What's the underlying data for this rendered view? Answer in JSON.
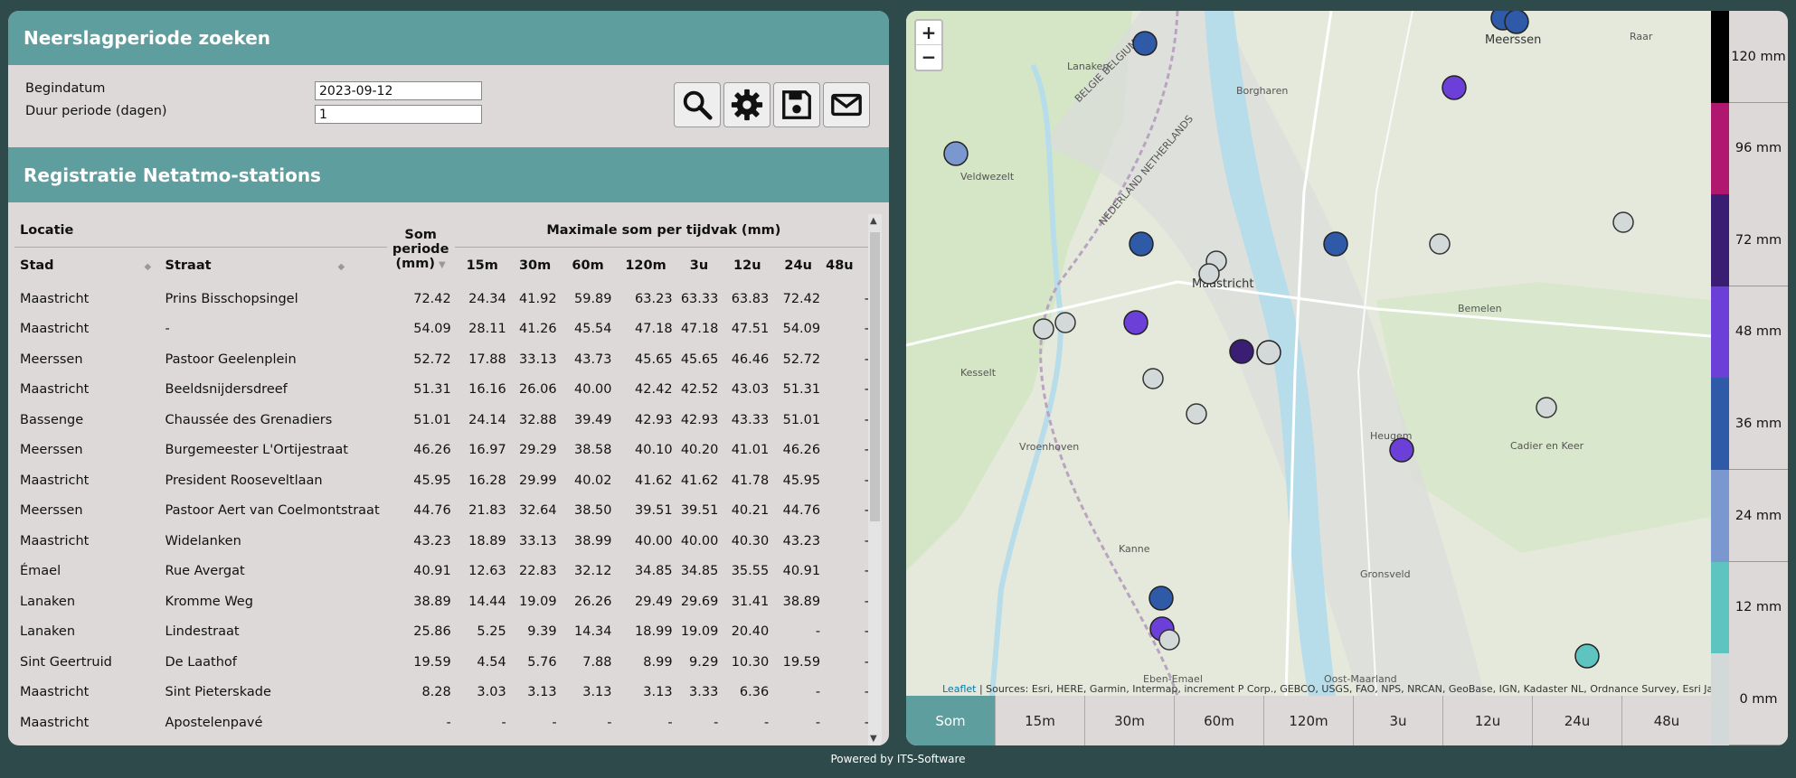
{
  "search": {
    "title": "Neerslagperiode zoeken",
    "start_label": "Begindatum",
    "start_value": "2023-09-12",
    "duration_label": "Duur periode (dagen)",
    "duration_value": "1",
    "buttons": [
      "search-icon",
      "gear-icon",
      "save-icon",
      "mail-icon"
    ]
  },
  "registry": {
    "title": "Registratie Netatmo-stations",
    "table": {
      "group_location": "Locatie",
      "group_max": "Maximale som per tijdvak (mm)",
      "col_city": "Stad",
      "col_street": "Straat",
      "col_sum": "Som periode (mm)",
      "periods": [
        "15m",
        "30m",
        "60m",
        "120m",
        "3u",
        "12u",
        "24u",
        "48u"
      ],
      "rows": [
        {
          "city": "Maastricht",
          "street": "Prins Bisschopsingel",
          "sum": "72.42",
          "v": [
            "24.34",
            "41.92",
            "59.89",
            "63.23",
            "63.33",
            "63.83",
            "72.42",
            "-"
          ]
        },
        {
          "city": "Maastricht",
          "street": "-",
          "sum": "54.09",
          "v": [
            "28.11",
            "41.26",
            "45.54",
            "47.18",
            "47.18",
            "47.51",
            "54.09",
            "-"
          ]
        },
        {
          "city": "Meerssen",
          "street": "Pastoor Geelenplein",
          "sum": "52.72",
          "v": [
            "17.88",
            "33.13",
            "43.73",
            "45.65",
            "45.65",
            "46.46",
            "52.72",
            "-"
          ]
        },
        {
          "city": "Maastricht",
          "street": "Beeldsnijdersdreef",
          "sum": "51.31",
          "v": [
            "16.16",
            "26.06",
            "40.00",
            "42.42",
            "42.52",
            "43.03",
            "51.31",
            "-"
          ]
        },
        {
          "city": "Bassenge",
          "street": "Chaussée des Grenadiers",
          "sum": "51.01",
          "v": [
            "24.14",
            "32.88",
            "39.49",
            "42.93",
            "42.93",
            "43.33",
            "51.01",
            "-"
          ]
        },
        {
          "city": "Meerssen",
          "street": "Burgemeester L'Ortijestraat",
          "sum": "46.26",
          "v": [
            "16.97",
            "29.29",
            "38.58",
            "40.10",
            "40.20",
            "41.01",
            "46.26",
            "-"
          ]
        },
        {
          "city": "Maastricht",
          "street": "President Rooseveltlaan",
          "sum": "45.95",
          "v": [
            "16.28",
            "29.99",
            "40.02",
            "41.62",
            "41.62",
            "41.78",
            "45.95",
            "-"
          ]
        },
        {
          "city": "Meerssen",
          "street": "Pastoor Aert van Coelmontstraat",
          "sum": "44.76",
          "v": [
            "21.83",
            "32.64",
            "38.50",
            "39.51",
            "39.51",
            "40.21",
            "44.76",
            "-"
          ]
        },
        {
          "city": "Maastricht",
          "street": "Widelanken",
          "sum": "43.23",
          "v": [
            "18.89",
            "33.13",
            "38.99",
            "40.00",
            "40.00",
            "40.30",
            "43.23",
            "-"
          ]
        },
        {
          "city": "Émael",
          "street": "Rue Avergat",
          "sum": "40.91",
          "v": [
            "12.63",
            "22.83",
            "32.12",
            "34.85",
            "34.85",
            "35.55",
            "40.91",
            "-"
          ]
        },
        {
          "city": "Lanaken",
          "street": "Kromme Weg",
          "sum": "38.89",
          "v": [
            "14.44",
            "19.09",
            "26.26",
            "29.49",
            "29.69",
            "31.41",
            "38.89",
            "-"
          ]
        },
        {
          "city": "Lanaken",
          "street": "Lindestraat",
          "sum": "25.86",
          "v": [
            "5.25",
            "9.39",
            "14.34",
            "18.99",
            "19.09",
            "20.40",
            "-",
            "-"
          ]
        },
        {
          "city": "Sint Geertruid",
          "street": "De Laathof",
          "sum": "19.59",
          "v": [
            "4.54",
            "5.76",
            "7.88",
            "8.99",
            "9.29",
            "10.30",
            "19.59",
            "-"
          ]
        },
        {
          "city": "Maastricht",
          "street": "Sint Pieterskade",
          "sum": "8.28",
          "v": [
            "3.03",
            "3.13",
            "3.13",
            "3.13",
            "3.33",
            "6.36",
            "-",
            "-"
          ]
        },
        {
          "city": "Maastricht",
          "street": "Apostelenpavé",
          "sum": "-",
          "v": [
            "-",
            "-",
            "-",
            "-",
            "-",
            "-",
            "-",
            "-"
          ]
        }
      ]
    }
  },
  "map": {
    "zoom_in": "+",
    "zoom_out": "−",
    "attribution_brand": "Leaflet",
    "attribution_text": " | Sources: Esri, HERE, Garmin, Intermap, increment P Corp., GEBCO, USGS, FAO, NPS, NRCAN, GeoBase, IGN, Kadaster NL, Ordnance Survey, Esri Japan, METI, E...",
    "labels": {
      "maastricht": "Maastricht",
      "meerssen": "Meerssen",
      "veldwezelt": "Veldwezelt",
      "borgharen": "Borgharen",
      "kesselt": "Kesselt",
      "vroenhoven": "Vroenhoven",
      "kanne": "Kanne",
      "eben_emael": "Eben-Emael",
      "bemelen": "Bemelen",
      "cadier": "Cadier en Keer",
      "gronsveld": "Gronsveld",
      "oost_maarland": "Oost-Maarland",
      "raar": "Raar",
      "heugem": "Heugem",
      "belgie": "BELGIE BELGIUM",
      "nederland": "NEDERLAND NETHERLANDS",
      "lanaken": "Lanaken"
    },
    "tabs": [
      "Som",
      "15m",
      "30m",
      "60m",
      "120m",
      "3u",
      "12u",
      "24u",
      "48u"
    ],
    "active_tab": "Som"
  },
  "legend": [
    {
      "label": "120 mm",
      "color": "#000000"
    },
    {
      "label": "96 mm",
      "color": "#b0186f"
    },
    {
      "label": "72 mm",
      "color": "#3a1e73"
    },
    {
      "label": "48 mm",
      "color": "#6c3fd8"
    },
    {
      "label": "36 mm",
      "color": "#2e5aa8"
    },
    {
      "label": "24 mm",
      "color": "#7b97d0"
    },
    {
      "label": "12 mm",
      "color": "#5ec4c0"
    },
    {
      "label": "0 mm",
      "color": "#d3d9d8"
    }
  ],
  "footer": "Powered by ITS-Software"
}
